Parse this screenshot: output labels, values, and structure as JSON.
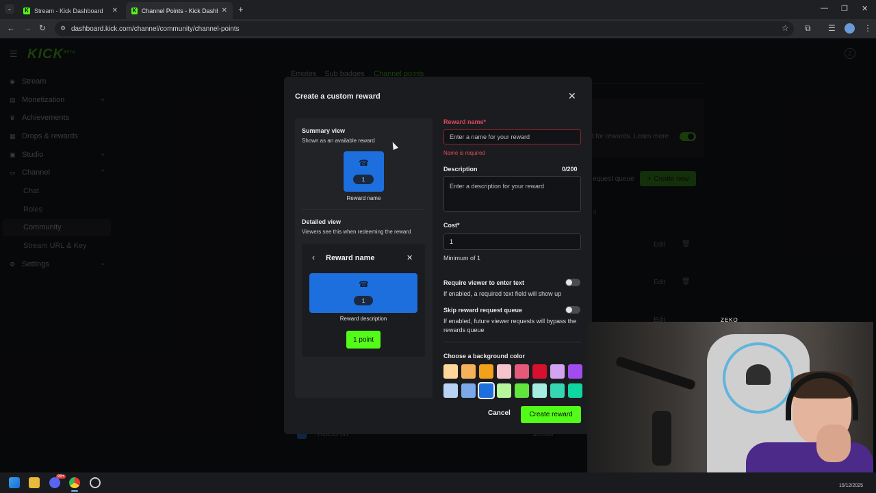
{
  "browser": {
    "tabs": [
      {
        "title": "Stream - Kick Dashboard",
        "close": "✕"
      },
      {
        "title": "Channel Points - Kick Dashboar",
        "close": "✕"
      }
    ],
    "new_tab": "+",
    "url": "dashboard.kick.com/channel/community/channel-points"
  },
  "sidebar": {
    "logo": "KICK",
    "logo_badge": "BETA",
    "items": [
      {
        "label": "Stream"
      },
      {
        "label": "Monetization"
      },
      {
        "label": "Achievements"
      },
      {
        "label": "Drops & rewards"
      },
      {
        "label": "Studio"
      },
      {
        "label": "Channel"
      }
    ],
    "channel_sub": [
      "Chat",
      "Roles",
      "Community",
      "Stream URL & Key"
    ],
    "settings": "Settings"
  },
  "background": {
    "tabs": [
      "Emotes",
      "Sub badges",
      "Channel points"
    ],
    "learn_more": "d for rewards. Learn more",
    "request_queue": "equest queue",
    "create_new": "Create new",
    "edit": "Edit",
    "letter_d": "d",
    "row_label": "HOCO IVI",
    "row_value": "50,000"
  },
  "modal": {
    "title": "Create a custom reward",
    "close": "✕",
    "summary": {
      "heading": "Summary view",
      "subtitle": "Shown as an available reward",
      "pill": "1",
      "caption": "Reward name"
    },
    "detailed": {
      "heading": "Detailed view",
      "subtitle": "Viewers see this when redeeming the reward",
      "header_title": "Reward name",
      "pill": "1",
      "description": "Reward description",
      "point_button": "1 point"
    },
    "form": {
      "name_label": "Reward name*",
      "name_placeholder": "Enter a name for your reward",
      "name_error": "Name is required",
      "desc_label": "Description",
      "desc_count": "0/200",
      "desc_placeholder": "Enter a description for your reward",
      "cost_label": "Cost*",
      "cost_value": "1",
      "cost_help": "Minimum of 1",
      "toggle1_label": "Require viewer to enter text",
      "toggle1_help": "If enabled, a required text field will show up",
      "toggle2_label": "Skip reward request queue",
      "toggle2_help": "If enabled, future viewer requests will bypass the rewards queue",
      "color_label": "Choose a background color",
      "colors_row1": [
        "#fdd89a",
        "#f6b25b",
        "#f3a01a",
        "#f7c4cd",
        "#e45a78",
        "#d6102e",
        "#d3a3f2",
        "#a24cf0"
      ],
      "colors_row2": [
        "#b8d3f4",
        "#7aa8e8",
        "#1d6fde",
        "#b7f79c",
        "#62e53c",
        "#a6ece0",
        "#36d5b4",
        "#0fd6a1"
      ],
      "selected_color": "#1d6fde"
    },
    "cancel": "Cancel",
    "create": "Create reward"
  },
  "overlay": {
    "webcam_brand": "ZEKO"
  },
  "taskbar": {
    "date": "15/12/2025",
    "discord_badge": "99+"
  }
}
